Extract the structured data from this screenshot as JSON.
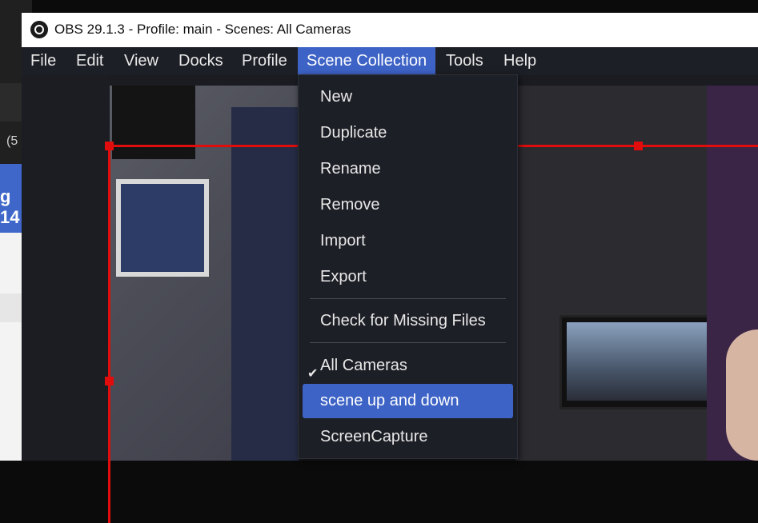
{
  "window": {
    "title": "OBS 29.1.3 - Profile: main - Scenes: All Cameras"
  },
  "background_app": {
    "paren_text": "(5",
    "banner_text": "g 14"
  },
  "menubar": {
    "items": [
      "File",
      "Edit",
      "View",
      "Docks",
      "Profile",
      "Scene Collection",
      "Tools",
      "Help"
    ],
    "active": "Scene Collection"
  },
  "scene_collection_menu": {
    "actions": [
      "New",
      "Duplicate",
      "Rename",
      "Remove",
      "Import",
      "Export"
    ],
    "check_missing": "Check for Missing Files",
    "collections": [
      "All Cameras",
      "scene up and down",
      "ScreenCapture"
    ],
    "checked_collection": "All Cameras",
    "hovered_item": "scene up and down",
    "check_mark": "✔"
  },
  "colors": {
    "accent": "#3d63c6",
    "selection_outline": "#e10d0d",
    "menu_background": "#1d1f26"
  }
}
